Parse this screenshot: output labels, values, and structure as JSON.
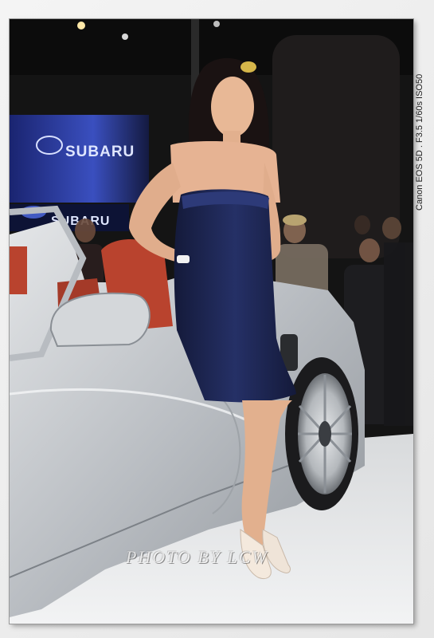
{
  "photo": {
    "exif_caption": "Canon EOS 5D . F3.5 1/60s ISO50",
    "watermark": "PHOTO BY LCW",
    "signs": [
      "SUBARU",
      "SUBARU"
    ]
  },
  "icons": {
    "brand_logo": "subaru-logo-icon"
  },
  "colors": {
    "dress": "#1c2550",
    "car_silver": "#c9cdd1",
    "seat_red": "#b9432e",
    "backdrop": "#141414",
    "sign_glow": "#2f3f9e"
  }
}
